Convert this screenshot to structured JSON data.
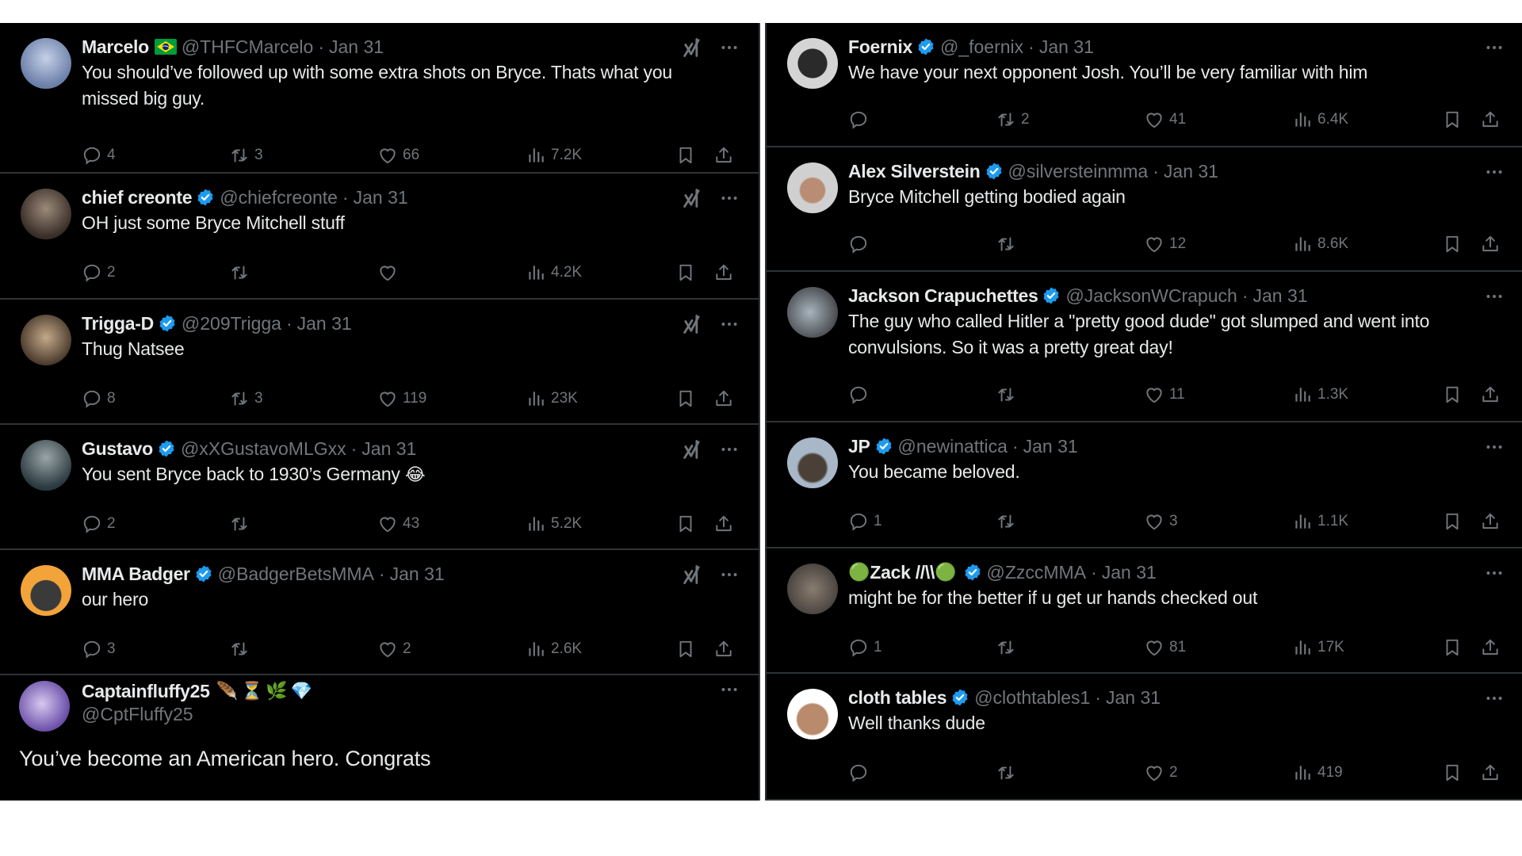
{
  "colors": {
    "background": "#000000",
    "page": "#ffffff",
    "text_primary": "#e7e9ea",
    "text_secondary": "#71767b",
    "divider": "#2f3336",
    "verified_blue": "#1d9bf0"
  },
  "left_column": [
    {
      "display_name": "Marcelo",
      "name_extra": "🇧🇷",
      "verified": false,
      "handle": "@THFCMarcelo",
      "date": "Jan 31",
      "text": "You should’ve followed up with some extra shots on Bryce. Thats what you missed big guy.",
      "replies": "4",
      "reposts": "3",
      "likes": "66",
      "views": "7.2K",
      "avatar_color": "#6b7fa8"
    },
    {
      "display_name": "chief creonte",
      "verified": true,
      "handle": "@chiefcreonte",
      "date": "Jan 31",
      "text": "OH just some Bryce Mitchell stuff",
      "replies": "2",
      "reposts": "",
      "likes": "",
      "views": "4.2K",
      "avatar_color": "#4a3b34"
    },
    {
      "display_name": "Trigga-D",
      "verified": true,
      "handle": "@209Trigga",
      "date": "Jan 31",
      "text": "Thug Natsee",
      "replies": "8",
      "reposts": "3",
      "likes": "119",
      "views": "23K",
      "avatar_color": "#7a6550"
    },
    {
      "display_name": "Gustavo",
      "verified": true,
      "handle": "@xXGustavoMLGxx",
      "date": "Jan 31",
      "text": "You sent Bryce back to 1930’s Germany",
      "text_emoji": "😂",
      "replies": "2",
      "reposts": "",
      "likes": "43",
      "views": "5.2K",
      "avatar_color": "#3d4a4f"
    },
    {
      "display_name": "MMA Badger",
      "verified": true,
      "handle": "@BadgerBetsMMA",
      "date": "Jan 31",
      "text": "our hero",
      "replies": "3",
      "reposts": "",
      "likes": "2",
      "views": "2.6K",
      "avatar_color": "#f2a33a"
    },
    {
      "display_name": "Captainfluffy25",
      "name_emojis": "🪶⏳🌿💎",
      "handle": "@CptFluffy25",
      "text": "You’ve become an American hero. Congrats",
      "avatar_color": "#7a5fb0"
    }
  ],
  "right_column": [
    {
      "display_name": "Foernix",
      "verified": true,
      "handle": "@_foernix",
      "date": "Jan 31",
      "text": "We have your next opponent Josh. You’ll be very familiar with him",
      "replies": "",
      "reposts": "2",
      "likes": "41",
      "views": "6.4K",
      "avatar_color": "#9a9a9a"
    },
    {
      "display_name": "Alex Silverstein",
      "verified": true,
      "handle": "@silversteinmma",
      "date": "Jan 31",
      "text": "Bryce Mitchell getting bodied again",
      "replies": "",
      "reposts": "",
      "likes": "12",
      "views": "8.6K",
      "avatar_color": "#c9c9c9"
    },
    {
      "display_name": "Jackson Crapuchettes",
      "verified": true,
      "handle": "@JacksonWCrapuch",
      "date": "Jan 31",
      "text": "The guy who called Hitler a \"pretty good dude\" got slumped and went into convulsions. So it was a pretty great day!",
      "replies": "",
      "reposts": "",
      "likes": "11",
      "views": "1.3K",
      "avatar_color": "#8d9aa3"
    },
    {
      "display_name": "JP",
      "verified": true,
      "handle": "@newinattica",
      "date": "Jan 31",
      "text": "You became beloved.",
      "replies": "1",
      "reposts": "",
      "likes": "3",
      "views": "1.1K",
      "avatar_color": "#7b8796"
    },
    {
      "display_name": "Zack //\\\\",
      "name_prefix_emoji": "🟢",
      "name_suffix_emoji": "🟢",
      "verified": true,
      "handle": "@ZzccMMA",
      "date": "Jan 31",
      "text": "might be for the better if u get ur hands checked out",
      "replies": "1",
      "reposts": "",
      "likes": "81",
      "views": "17K",
      "avatar_color": "#6e6a66"
    },
    {
      "display_name": "cloth tables",
      "verified": true,
      "handle": "@clothtables1",
      "date": "Jan 31",
      "text": "Well thanks dude",
      "replies": "",
      "reposts": "",
      "likes": "2",
      "views": "419",
      "avatar_color": "#c8a58e"
    }
  ],
  "icons": {
    "reply": "reply-icon",
    "repost": "repost-icon",
    "like": "like-icon",
    "views": "views-icon",
    "bookmark": "bookmark-icon",
    "share": "share-icon",
    "more": "more-icon",
    "grok": "grok-icon",
    "verified": "verified-badge-icon"
  }
}
